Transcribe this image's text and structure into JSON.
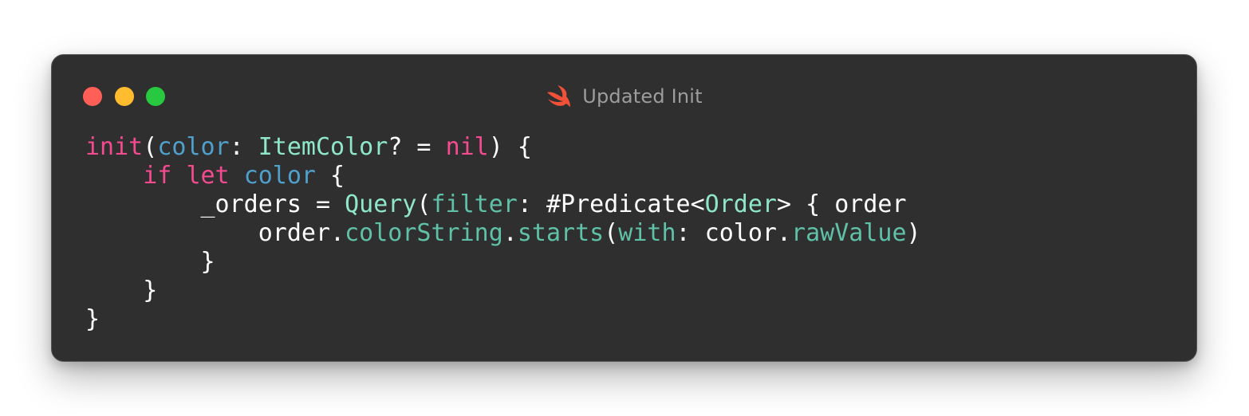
{
  "window": {
    "title": "Updated Init",
    "title_icon": "swift-icon",
    "controls": [
      {
        "name": "close",
        "color": "#ff5f57"
      },
      {
        "name": "minimize",
        "color": "#febc2e"
      },
      {
        "name": "zoom",
        "color": "#28c840"
      }
    ]
  },
  "colors": {
    "keyword": "#f44a8f",
    "parameter": "#4fa0cc",
    "type": "#8ee7c9",
    "function": "#5fc1a7",
    "plain": "#ffffff",
    "background": "#2f2f2f"
  },
  "code": {
    "lines": [
      [
        {
          "t": "init",
          "k": "kw"
        },
        {
          "t": "(",
          "k": "plain"
        },
        {
          "t": "color",
          "k": "param"
        },
        {
          "t": ": ",
          "k": "plain"
        },
        {
          "t": "ItemColor",
          "k": "type"
        },
        {
          "t": "? = ",
          "k": "plain"
        },
        {
          "t": "nil",
          "k": "kw"
        },
        {
          "t": ") {",
          "k": "plain"
        }
      ],
      [
        {
          "t": "    ",
          "k": "plain"
        },
        {
          "t": "if",
          "k": "kw"
        },
        {
          "t": " ",
          "k": "plain"
        },
        {
          "t": "let",
          "k": "kw"
        },
        {
          "t": " ",
          "k": "plain"
        },
        {
          "t": "color",
          "k": "param"
        },
        {
          "t": " {",
          "k": "plain"
        }
      ],
      [
        {
          "t": "        _orders = ",
          "k": "plain"
        },
        {
          "t": "Query",
          "k": "type"
        },
        {
          "t": "(",
          "k": "plain"
        },
        {
          "t": "filter",
          "k": "fn"
        },
        {
          "t": ": #Predicate<",
          "k": "plain"
        },
        {
          "t": "Order",
          "k": "type"
        },
        {
          "t": "> { order",
          "k": "plain"
        }
      ],
      [
        {
          "t": "            order.",
          "k": "plain"
        },
        {
          "t": "colorString",
          "k": "fn"
        },
        {
          "t": ".",
          "k": "plain"
        },
        {
          "t": "starts",
          "k": "fn"
        },
        {
          "t": "(",
          "k": "plain"
        },
        {
          "t": "with",
          "k": "fn"
        },
        {
          "t": ": color.",
          "k": "plain"
        },
        {
          "t": "rawValue",
          "k": "fn"
        },
        {
          "t": ")",
          "k": "plain"
        }
      ],
      [
        {
          "t": "        }",
          "k": "plain"
        }
      ],
      [
        {
          "t": "    }",
          "k": "plain"
        }
      ],
      [
        {
          "t": "}",
          "k": "plain"
        }
      ]
    ]
  }
}
